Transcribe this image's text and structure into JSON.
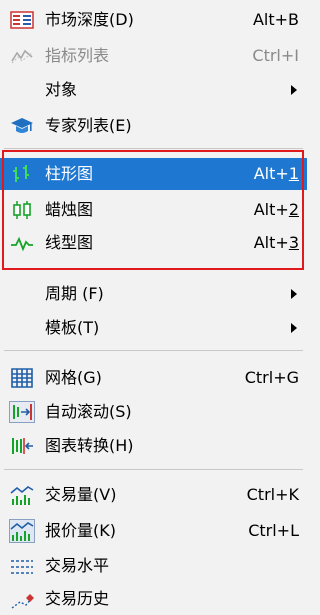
{
  "menu": {
    "items": [
      {
        "label": "市场深度(D)",
        "shortcut": "Alt+B",
        "icon": "market-depth-icon"
      },
      {
        "label": "指标列表",
        "shortcut": "Ctrl+I",
        "icon": "indicators-icon",
        "disabled": true
      },
      {
        "label": "对象",
        "submenu": true
      },
      {
        "label": "专家列表(E)",
        "icon": "experts-icon"
      },
      {
        "label": "柱形图",
        "shortcut_prefix": "Alt+",
        "shortcut_key": "1",
        "icon": "bar-chart-icon",
        "selected": true
      },
      {
        "label": "蜡烛图",
        "shortcut_prefix": "Alt+",
        "shortcut_key": "2",
        "icon": "candlestick-icon"
      },
      {
        "label": "线型图",
        "shortcut_prefix": "Alt+",
        "shortcut_key": "3",
        "icon": "line-chart-icon"
      },
      {
        "label": "周期 (F)",
        "submenu": true
      },
      {
        "label": "模板(T)",
        "submenu": true
      },
      {
        "label": "网格(G)",
        "shortcut": "Ctrl+G",
        "icon": "grid-icon"
      },
      {
        "label": "自动滚动(S)",
        "icon": "auto-scroll-icon"
      },
      {
        "label": "图表转换(H)",
        "icon": "chart-shift-icon"
      },
      {
        "label": "交易量(V)",
        "shortcut": "Ctrl+K",
        "icon": "volume-icon"
      },
      {
        "label": "报价量(K)",
        "shortcut": "Ctrl+L",
        "icon": "tick-volume-icon"
      },
      {
        "label": "交易水平",
        "icon": "trade-levels-icon"
      },
      {
        "label": "交易历史",
        "icon": "trade-history-icon"
      }
    ]
  },
  "colors": {
    "selected_bg": "#1e78d2",
    "highlight_border": "#e0191c",
    "background": "#f2f2f2"
  }
}
